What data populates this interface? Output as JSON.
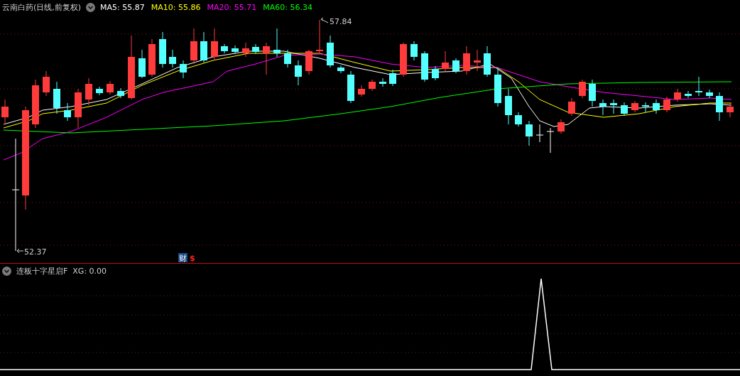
{
  "main_chart": {
    "title": "云南白药(日线,前复权)",
    "moving_averages": [
      {
        "label": "MA5: 55.87",
        "color": "#ffffff"
      },
      {
        "label": "MA10: 55.86",
        "color": "#ffff00"
      },
      {
        "label": "MA20: 55.71",
        "color": "#ff00ff"
      },
      {
        "label": "MA60: 56.34",
        "color": "#00ff00"
      }
    ],
    "high_label": "57.84",
    "low_label": "52.37",
    "badges": [
      {
        "text": "财",
        "kind": "finance"
      },
      {
        "text": "$",
        "kind": "dollar"
      }
    ]
  },
  "indicator": {
    "name": "连板十字星启F",
    "reading": "XG: 0.00"
  }
}
